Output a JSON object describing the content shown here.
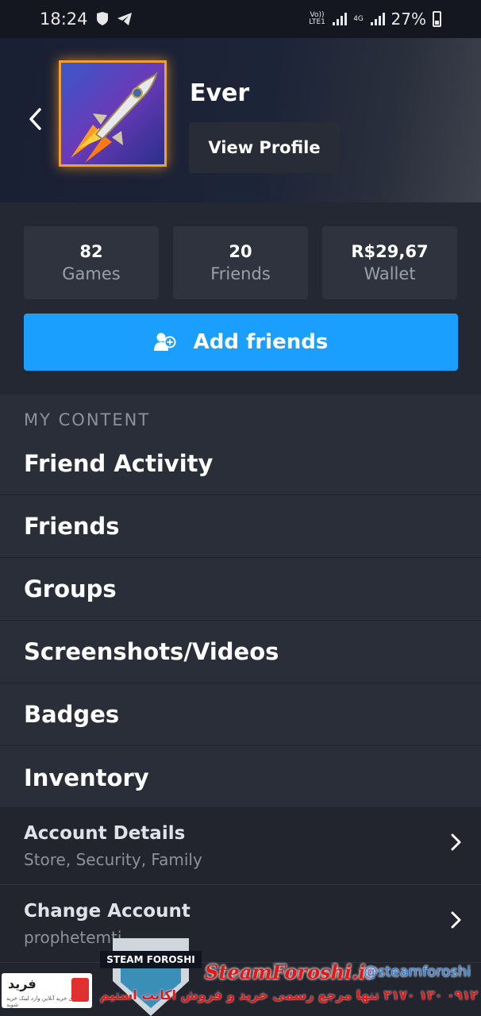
{
  "status_bar": {
    "time": "18:24",
    "network_1": "Vo)) LTE1",
    "network_2": "4G",
    "battery": "27%"
  },
  "header": {
    "username": "Ever",
    "view_profile_label": "View Profile"
  },
  "stats": [
    {
      "value": "82",
      "label": "Games"
    },
    {
      "value": "20",
      "label": "Friends"
    },
    {
      "value": "R$29,67",
      "label": "Wallet"
    }
  ],
  "add_friends_label": "Add friends",
  "my_content": {
    "title": "MY CONTENT",
    "items": [
      "Friend Activity",
      "Friends",
      "Groups",
      "Screenshots/Videos",
      "Badges",
      "Inventory"
    ]
  },
  "account": [
    {
      "title": "Account Details",
      "subtitle": "Store, Security, Family"
    },
    {
      "title": "Change Account",
      "subtitle": "prophetemti"
    }
  ],
  "watermark": {
    "brand": "STEAM FOROSHI",
    "site": "SteamForoshi.ir",
    "handle": "@steamforoshi",
    "tagline": "تنها مرجع رسمی خرید و فروش اکانت استیم",
    "phone": "۰۹۱۲ ۱۳۰ ۳۱۷۰",
    "left_badge": "فرید",
    "left_badge_sub": "برای خرید آنلاین وارد لینک خرید شوید"
  },
  "colors": {
    "accent_blue": "#1a9fff",
    "background": "#1b1e25",
    "avatar_border": "#f1a030"
  }
}
